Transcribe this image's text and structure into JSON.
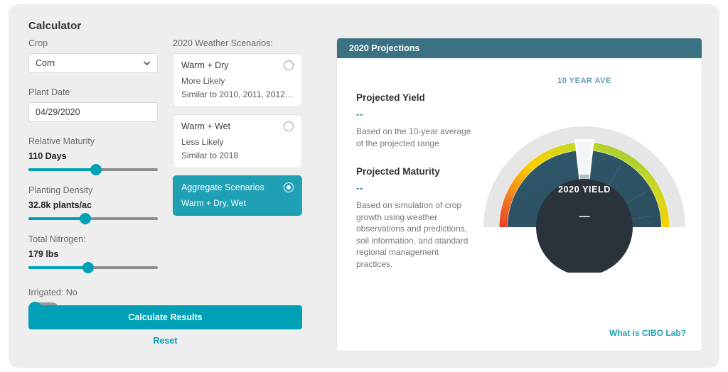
{
  "app": {
    "title": "Calculator"
  },
  "form": {
    "crop": {
      "label": "Crop",
      "value": "Corn",
      "icon": "chevron-down-icon"
    },
    "plant_date": {
      "label": "Plant Date",
      "value": "04/29/2020",
      "placeholder": "MM/DD/YYYY"
    },
    "relative_maturity": {
      "label": "Relative Maturity",
      "value": "110 Days",
      "percent": 52
    },
    "planting_density": {
      "label": "Planting Density",
      "value": "32.8k plants/ac",
      "percent": 44
    },
    "total_nitrogen": {
      "label": "Total Nitrogen:",
      "value": "179 lbs",
      "percent": 46
    },
    "irrigated": {
      "label": "Irrigated: No",
      "on": false
    },
    "calculate_label": "Calculate Results",
    "reset_label": "Reset"
  },
  "scenarios": {
    "heading": "2020 Weather Scenarios:",
    "items": [
      {
        "title": "Warm + Dry",
        "likelihood": "More Likely",
        "similar": "Similar to 2010, 2011, 2012, 20…",
        "selected": false
      },
      {
        "title": "Warm + Wet",
        "likelihood": "Less Likely",
        "similar": "Similar to 2018",
        "selected": false
      },
      {
        "title": "Aggregate Scenarios",
        "likelihood": "Warm + Dry, Wet",
        "similar": "",
        "selected": true
      }
    ]
  },
  "projections": {
    "header": "2020 Projections",
    "yield": {
      "heading": "Projected Yield",
      "value": "--",
      "description": "Based on the 10-year average of the projected range"
    },
    "maturity": {
      "heading": "Projected Maturity",
      "value": "--",
      "description": "Based on simulation of crop growth using weather observations and predictions, soil information, and standard regional management practices."
    },
    "cibo_link": "What is CIBO Lab?"
  },
  "gauge": {
    "top_label": "10 YEAR AVE",
    "center_label": "2020 YIELD",
    "center_value": "—",
    "needle_percent": 50,
    "marker_percent": 50,
    "colors": {
      "red": "#e8412a",
      "orange": "#f5821f",
      "yellow": "#fbd000",
      "yellow_green": "#c8d824",
      "green": "#7ac142",
      "outer_ring": "#e6e6e6",
      "dial_face": "#2e5566",
      "inner_disc": "#2a333b",
      "needle": "#a9b4ba"
    }
  },
  "theme": {
    "teal": "#00a0b7",
    "header_teal": "#3a7284",
    "page_bg": "#eeeeee",
    "card_white": "#ffffff"
  }
}
